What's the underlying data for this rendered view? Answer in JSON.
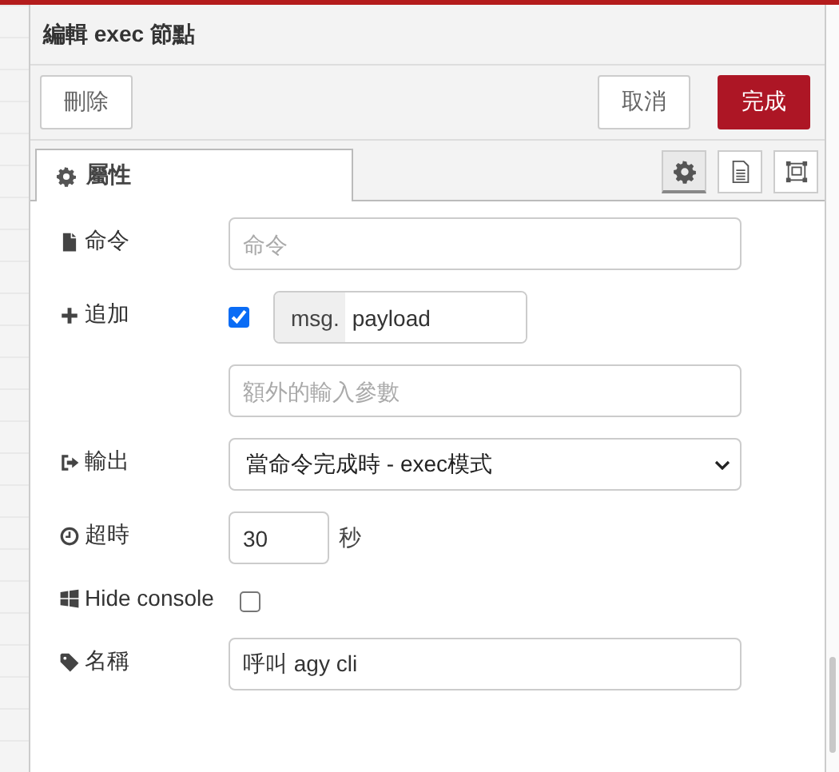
{
  "dialog": {
    "title": "編輯 exec 節點"
  },
  "buttons": [
    {
      "label": "刪除",
      "kind": "plain"
    },
    {
      "label": "取消",
      "kind": "plain"
    },
    {
      "label": "完成",
      "kind": "primary"
    }
  ],
  "tabs": [
    {
      "label": "屬性",
      "selected": true
    }
  ],
  "tab_tools": [
    {
      "kind": "settings",
      "selected": true
    },
    {
      "kind": "description",
      "selected": false
    },
    {
      "kind": "appearance",
      "selected": false
    }
  ],
  "form": [
    {
      "kind": "text",
      "label": "命令",
      "placeholder": "命令"
    },
    {
      "kind": "append",
      "label": "追加",
      "checked": true,
      "prefix": "msg.",
      "value": "payload",
      "extra_placeholder": "額外的輸入參數"
    },
    {
      "kind": "select",
      "label": "輸出",
      "value": "當命令完成時 - exec模式"
    },
    {
      "kind": "number",
      "label": "超時",
      "value": "30",
      "unit": "秒"
    },
    {
      "kind": "checkbox",
      "label": "Hide console",
      "checked": false
    },
    {
      "kind": "text",
      "label": "名稱",
      "value": "呼叫 agy cli"
    }
  ]
}
